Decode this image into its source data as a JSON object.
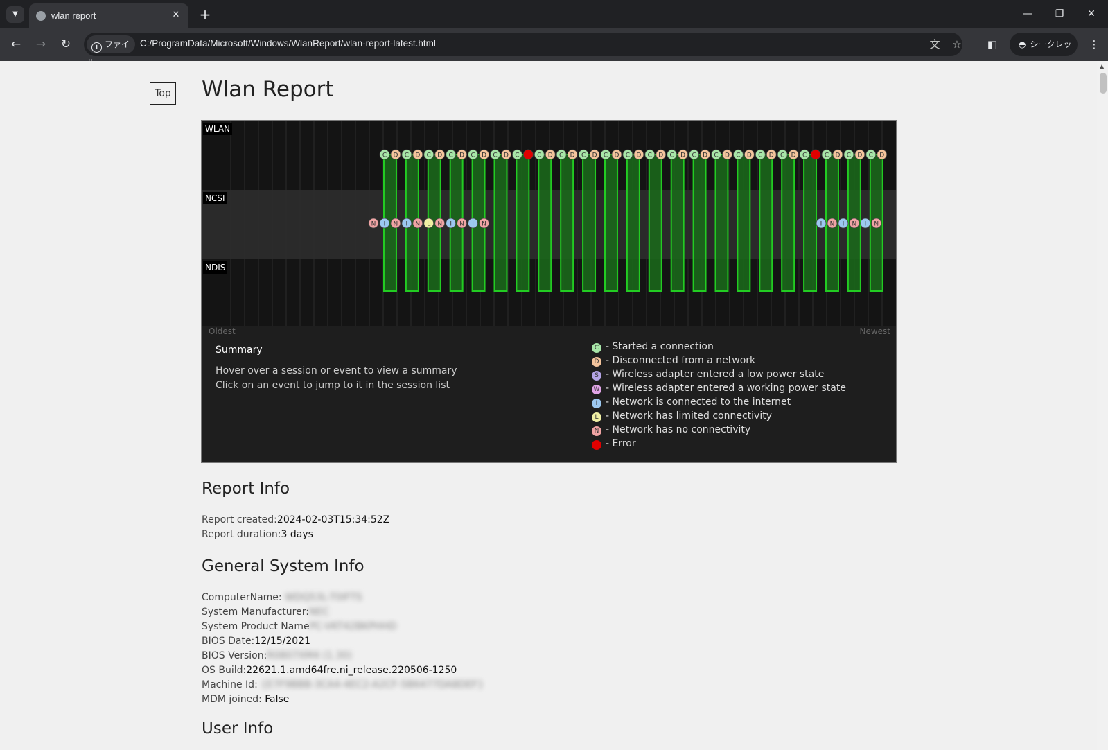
{
  "browser": {
    "tab_title": "wlan report",
    "security_chip": "ファイル",
    "url": "C:/ProgramData/Microsoft/Windows/WlanReport/wlan-report-latest.html",
    "incognito_label": "シークレット"
  },
  "page": {
    "top_button": "Top",
    "title": "Wlan Report",
    "timeline": {
      "lanes": [
        "WLAN",
        "NCSI",
        "NDIS"
      ],
      "oldest_label": "Oldest",
      "newest_label": "Newest",
      "wlan_events": [
        "C",
        "D",
        "C",
        "D",
        "C",
        "D",
        "C",
        "D",
        "C",
        "D",
        "C",
        "D",
        "C",
        "X",
        "C",
        "D",
        "C",
        "D",
        "C",
        "D",
        "C",
        "D",
        "C",
        "D",
        "C",
        "D",
        "C",
        "D",
        "C",
        "D",
        "C",
        "D",
        "C",
        "D",
        "C",
        "D",
        "C",
        "D",
        "C",
        "X",
        "C",
        "D",
        "C",
        "D",
        "C",
        "D"
      ],
      "ncsi_left_events": [
        "N",
        "I",
        "N",
        "I",
        "N",
        "L",
        "N",
        "I",
        "N",
        "I",
        "N"
      ],
      "ncsi_right_events": [
        "I",
        "N",
        "I",
        "N",
        "I",
        "N"
      ],
      "summary_heading": "Summary",
      "summary_line1": "Hover over a session or event to view a summary",
      "summary_line2": "Click on an event to jump to it in the session list",
      "legend": [
        {
          "letter": "C",
          "text": "- Started a connection",
          "color": "#a8e6a8"
        },
        {
          "letter": "D",
          "text": "- Disconnected from a network",
          "color": "#f4c49c"
        },
        {
          "letter": "S",
          "text": "- Wireless adapter entered a low power state",
          "color": "#b4a4e6"
        },
        {
          "letter": "W",
          "text": "- Wireless adapter entered a working power state",
          "color": "#e0a4e6"
        },
        {
          "letter": "I",
          "text": "- Network is connected to the internet",
          "color": "#9cc8f0"
        },
        {
          "letter": "L",
          "text": "- Network has limited connectivity",
          "color": "#f0f0a4"
        },
        {
          "letter": "N",
          "text": "- Network has no connectivity",
          "color": "#f0a4a4"
        },
        {
          "letter": "X",
          "text": "- Error",
          "color": "#e00000"
        }
      ],
      "colors": {
        "C": "#a8e6a8",
        "D": "#f4c49c",
        "I": "#9cc8f0",
        "L": "#f0f0a4",
        "N": "#f0a4a4",
        "X": "#e00000",
        "session_fill": "#1a6b1a",
        "session_stroke": "#22cc22"
      }
    },
    "report_info": {
      "heading": "Report Info",
      "created_label": "Report created:",
      "created_value": "2024-02-03T15:34:52Z",
      "duration_label": "Report duration:",
      "duration_value": "3 days"
    },
    "system_info": {
      "heading": "General System Info",
      "computer_name_label": "ComputerName: ",
      "computer_name_value": "WDQ53L-T0IFTS",
      "manufacturer_label": "System Manufacturer:",
      "manufacturer_value": "NEC",
      "product_label": "System Product Name",
      "product_value": "PC-VKT42BKPHHD",
      "bios_date_label": "BIOS Date:",
      "bios_date_value": "12/15/2021",
      "bios_version_label": "BIOS Version:",
      "bios_version_value": "R0807XM4 (1.30)",
      "os_build_label": "OS Build:",
      "os_build_value": "22621.1.amd64fre.ni_release.220506-1250",
      "machine_id_label": "Machine Id: ",
      "machine_id_value": "{E7F9BBB-3CA4-4EC2-A2CF-5B6477DA8DEF}",
      "mdm_label": "MDM joined: ",
      "mdm_value": "False"
    },
    "user_info": {
      "heading": "User Info"
    }
  }
}
